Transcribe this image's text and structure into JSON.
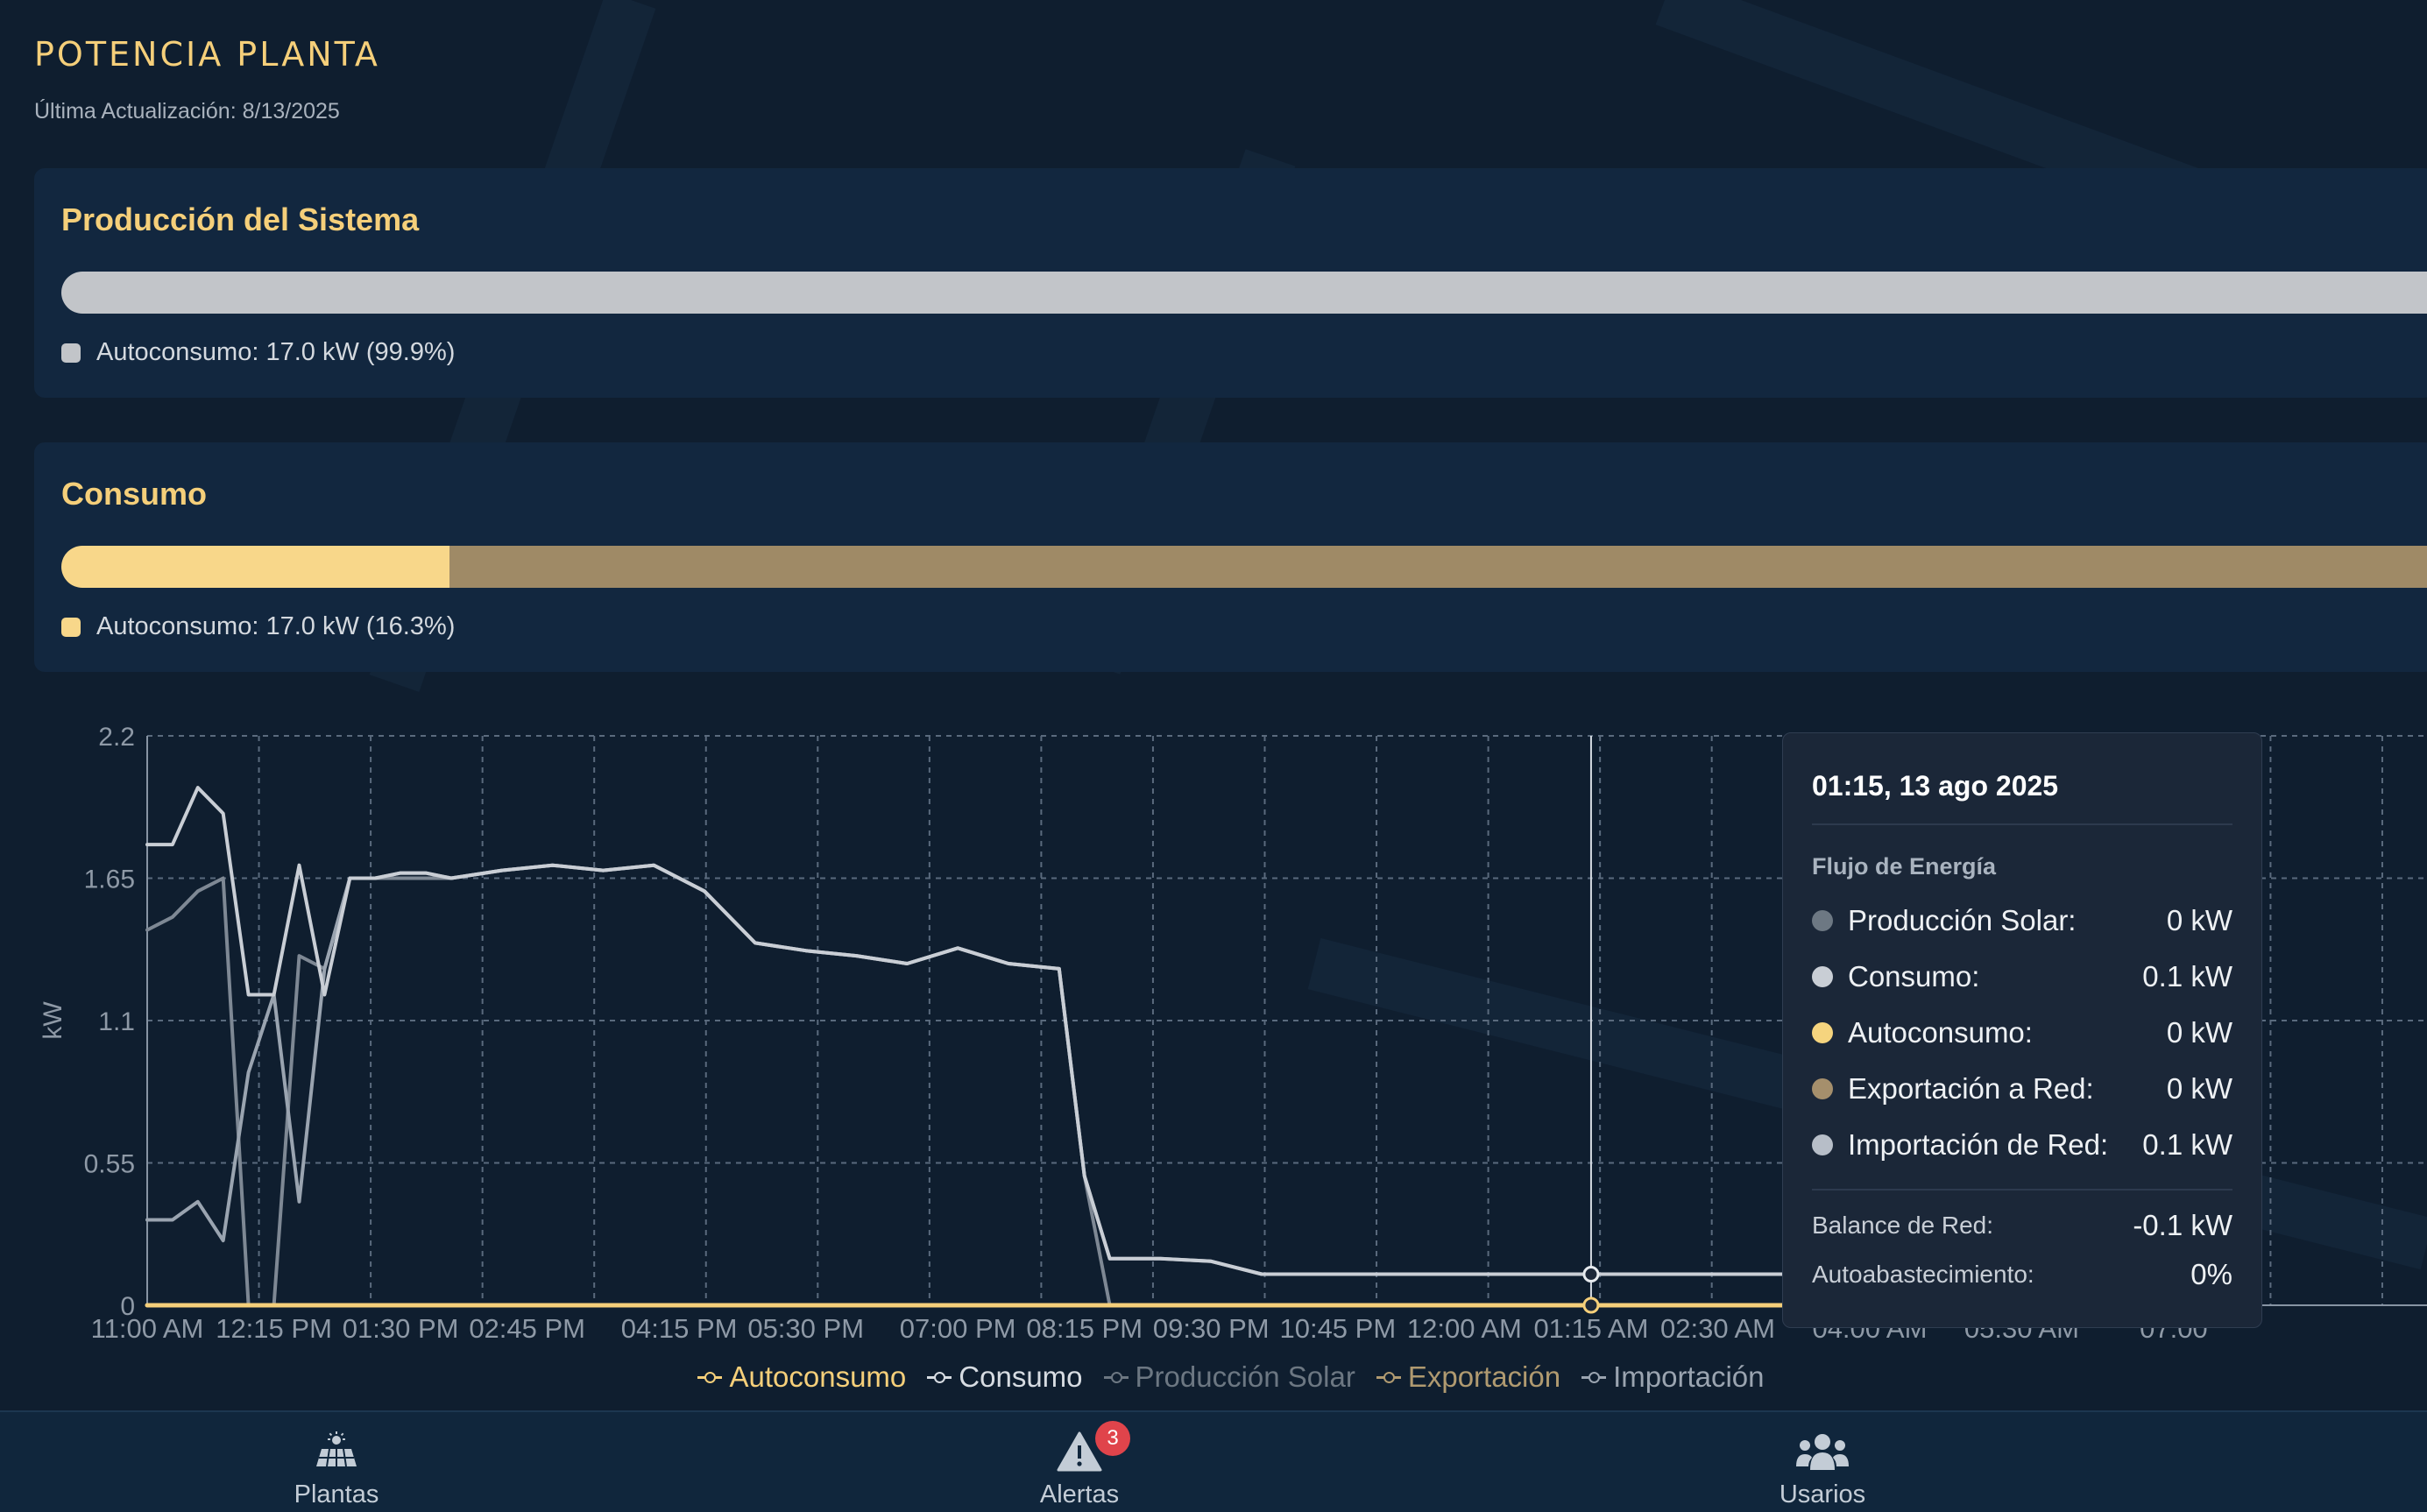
{
  "header": {
    "title": "POTENCIA PLANTA",
    "last_update": "Última Actualización: 8/13/2025"
  },
  "production_card": {
    "title": "Producción del Sistema",
    "legend": "Autoconsumo: 17.0 kW (99.9%)",
    "autoconsumo_fraction": 0.999,
    "colors": {
      "autoconsumo": "#c2c5c9",
      "exportacion": "#9f8a66"
    }
  },
  "consumption_card": {
    "title": "Consumo",
    "legend": "Autoconsumo: 17.0 kW (16.3%)",
    "autoconsumo_fraction": 0.163,
    "colors": {
      "autoconsumo": "#f8d78a",
      "importacion": "#9f8a66"
    }
  },
  "chart_data": {
    "type": "line",
    "ylabel": "kW",
    "ylim": [
      0,
      2.2
    ],
    "y_ticks": [
      "0",
      "0.55",
      "1.1",
      "1.65",
      "2.2"
    ],
    "x_tick_labels": [
      "11:00 AM",
      "12:15 PM",
      "01:30 PM",
      "02:45 PM",
      "04:15 PM",
      "05:30 PM",
      "07:00 PM",
      "08:15 PM",
      "09:30 PM",
      "10:45 PM",
      "12:00 AM",
      "01:15 AM",
      "02:30 AM",
      "04:00 AM",
      "05:30 AM",
      "07:00"
    ],
    "grid": true,
    "x_hours": [
      0,
      0.25,
      0.5,
      0.75,
      1.0,
      1.25,
      1.5,
      1.75,
      2.0,
      2.25,
      2.5,
      2.75,
      3.0,
      3.5,
      4.0,
      4.5,
      5.0,
      5.5,
      6.0,
      6.5,
      7.0,
      7.5,
      8.0,
      8.5,
      9.0,
      9.25,
      9.5,
      9.75,
      10.0,
      10.5,
      11.0,
      11.5,
      12.0,
      13.0,
      14.0,
      15.0,
      16.0,
      17.0,
      18.0,
      19.0,
      19.5,
      20.0
    ],
    "series": [
      {
        "name": "Autoconsumo",
        "color": "#f5cf7a",
        "values": [
          0,
          0,
          0,
          0,
          0,
          0,
          0,
          0,
          0,
          0,
          0,
          0,
          0,
          0,
          0,
          0,
          0,
          0,
          0,
          0,
          0,
          0,
          0,
          0,
          0,
          0,
          0,
          0,
          0,
          0,
          0,
          0,
          0,
          0,
          0,
          0,
          0,
          0,
          0,
          0,
          0,
          0
        ]
      },
      {
        "name": "Consumo",
        "color": "#c9ced5",
        "values": [
          1.78,
          1.78,
          2.0,
          1.9,
          1.2,
          1.2,
          1.7,
          1.2,
          1.65,
          1.65,
          1.67,
          1.67,
          1.65,
          1.68,
          1.7,
          1.68,
          1.7,
          1.6,
          1.4,
          1.37,
          1.35,
          1.32,
          1.38,
          1.32,
          1.3,
          0.5,
          0.18,
          0.18,
          0.18,
          0.17,
          0.12,
          0.12,
          0.12,
          0.12,
          0.12,
          0.12,
          0.12,
          0.12,
          0.12,
          0.12,
          0.18,
          0.18
        ]
      },
      {
        "name": "Producción Solar",
        "color": "#7e8894",
        "values": [
          1.45,
          1.5,
          1.6,
          1.65,
          0.0,
          0.0,
          1.35,
          1.3,
          1.65,
          1.65,
          1.65,
          1.65,
          1.65,
          1.68,
          1.7,
          1.68,
          1.7,
          1.6,
          1.4,
          1.37,
          1.35,
          1.32,
          1.38,
          1.32,
          1.3,
          0.5,
          0.0,
          0.0,
          0.0,
          0.0,
          0.0,
          0.0,
          0.0,
          0.0,
          0.0,
          0.0,
          0.0,
          0.0,
          0.0,
          0.0,
          0.08,
          0.05
        ]
      },
      {
        "name": "Exportación",
        "color": "#b09a70",
        "values": [
          0,
          0,
          0,
          0,
          0,
          0,
          0,
          0,
          0,
          0,
          0,
          0,
          0,
          0,
          0,
          0,
          0,
          0,
          0,
          0,
          0,
          0,
          0,
          0,
          0,
          0,
          0,
          0,
          0,
          0,
          0,
          0,
          0,
          0,
          0,
          0,
          0,
          0,
          0,
          0,
          0,
          0
        ]
      },
      {
        "name": "Importación",
        "color": "#9aa4b0",
        "values": [
          0.33,
          0.33,
          0.4,
          0.25,
          0.9,
          1.2,
          0.4,
          1.3,
          1.65,
          1.65,
          1.67,
          1.67,
          1.65,
          1.68,
          1.7,
          1.68,
          1.7,
          1.6,
          1.4,
          1.37,
          1.35,
          1.32,
          1.38,
          1.32,
          1.3,
          0.5,
          0.18,
          0.18,
          0.18,
          0.17,
          0.12,
          0.12,
          0.12,
          0.12,
          0.12,
          0.12,
          0.12,
          0.12,
          0.12,
          0.12,
          0.1,
          0.13
        ]
      }
    ]
  },
  "tooltip": {
    "date": "01:15, 13 ago 2025",
    "section": "Flujo de Energía",
    "rows": [
      {
        "label": "Producción Solar:",
        "value": "0 kW",
        "color": "#6d7883"
      },
      {
        "label": "Consumo:",
        "value": "0.1 kW",
        "color": "#c9ced5"
      },
      {
        "label": "Autoconsumo:",
        "value": "0 kW",
        "color": "#f5d47e"
      },
      {
        "label": "Exportación a Red:",
        "value": "0 kW",
        "color": "#a58f6c"
      },
      {
        "label": "Importación de Red:",
        "value": "0.1 kW",
        "color": "#b7bec8"
      }
    ],
    "balance_label": "Balance de Red:",
    "balance_value": "-0.1 kW",
    "auto_label": "Autoabastecimiento:",
    "auto_value": "0%"
  },
  "legend": [
    {
      "label": "Autoconsumo",
      "color": "#f5cf7a"
    },
    {
      "label": "Consumo",
      "color": "#d7dce2"
    },
    {
      "label": "Producción Solar",
      "color": "#6c7782"
    },
    {
      "label": "Exportación",
      "color": "#b09a70"
    },
    {
      "label": "Importación",
      "color": "#9aa4b0"
    }
  ],
  "nav": {
    "plantas": "Plantas",
    "alertas": "Alertas",
    "alertas_badge": "3",
    "usuarios": "Usarios"
  }
}
